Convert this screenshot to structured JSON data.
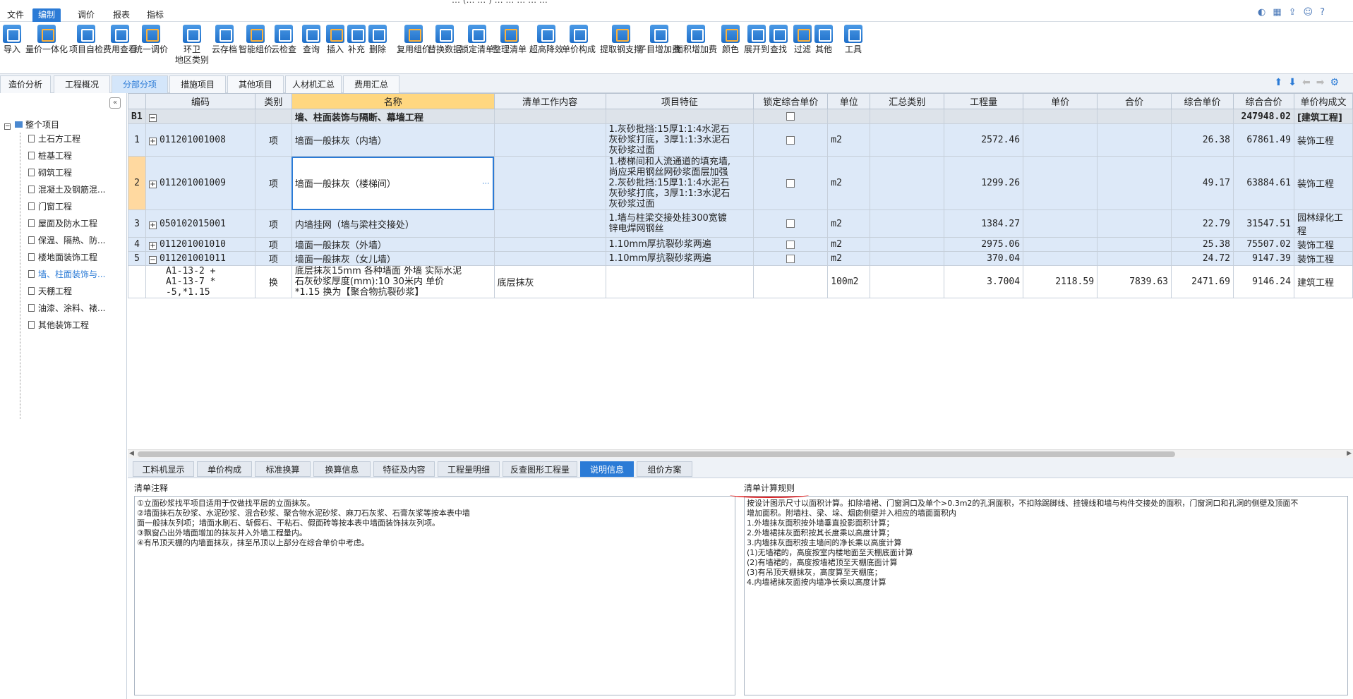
{
  "menu": [
    "文件",
    "编制",
    "调价",
    "报表",
    "指标"
  ],
  "title_fragment": "…  (… …  )  …  …  …  …  …",
  "ribbon": [
    {
      "label": "导入",
      "icon": "import-icon"
    },
    {
      "label": "量价一体化",
      "icon": "price-quantity-icon"
    },
    {
      "label": "项目自检",
      "icon": "self-check-icon"
    },
    {
      "label": "费用查看",
      "icon": "cost-view-icon"
    },
    {
      "label": "统一调价",
      "icon": "adjust-price-icon"
    },
    {
      "label": "环卫",
      "label2": "地区类别",
      "icon": "region-icon"
    },
    {
      "label": "云存档",
      "icon": "cloud-save-icon"
    },
    {
      "label": "智能组价",
      "icon": "smart-price-icon"
    },
    {
      "label": "云检查",
      "icon": "cloud-check-icon"
    },
    {
      "label": "查询",
      "icon": "query-icon"
    },
    {
      "label": "插入",
      "icon": "insert-icon"
    },
    {
      "label": "补充",
      "icon": "supplement-icon"
    },
    {
      "label": "删除",
      "icon": "delete-icon"
    },
    {
      "label": "复用组价",
      "icon": "reuse-icon"
    },
    {
      "label": "替换数据",
      "icon": "replace-icon"
    },
    {
      "label": "锁定清单",
      "icon": "lock-icon"
    },
    {
      "label": "整理清单",
      "icon": "organize-icon"
    },
    {
      "label": "超高降效",
      "icon": "height-icon"
    },
    {
      "label": "单价构成",
      "icon": "unit-price-icon"
    },
    {
      "label": "提取钢支撑",
      "icon": "steel-icon"
    },
    {
      "label": "子目增加费",
      "icon": "add-fee-icon"
    },
    {
      "label": "面积增加费",
      "icon": "area-fee-icon"
    },
    {
      "label": "颜色",
      "icon": "color-icon"
    },
    {
      "label": "展开到",
      "icon": "expand-icon"
    },
    {
      "label": "查找",
      "icon": "find-icon"
    },
    {
      "label": "过滤",
      "icon": "filter-icon"
    },
    {
      "label": "其他",
      "icon": "other-icon"
    },
    {
      "label": "工具",
      "icon": "tools-icon"
    }
  ],
  "main_tabs": [
    "造价分析",
    "工程概况",
    "分部分项",
    "措施项目",
    "其他项目",
    "人材机汇总",
    "费用汇总"
  ],
  "tree": {
    "root": "整个项目",
    "items": [
      "土石方工程",
      "桩基工程",
      "砌筑工程",
      "混凝土及钢筋混...",
      "门窗工程",
      "屋面及防水工程",
      "保温、隔热、防...",
      "楼地面装饰工程",
      "墙、柱面装饰与...",
      "天棚工程",
      "油漆、涂料、裱...",
      "其他装饰工程"
    ],
    "selected_index": 8
  },
  "columns": [
    "",
    "编码",
    "类别",
    "名称",
    "清单工作内容",
    "项目特征",
    "锁定综合单价",
    "单位",
    "汇总类别",
    "工程量",
    "单价",
    "合价",
    "综合单价",
    "综合合价",
    "单价构成文"
  ],
  "b1": {
    "no": "B1",
    "name": "墙、柱面装饰与隔断、幕墙工程",
    "total": "247948.02",
    "cat": "[建筑工程]"
  },
  "rows": [
    {
      "no": "1",
      "code": "011201001008",
      "type": "项",
      "name": "墙面一般抹灰（内墙）",
      "content": "",
      "feature": "1.灰砂批挡:15厚1:1:4水泥石\n灰砂浆打底，3厚1:1:3水泥石\n灰砂浆过面",
      "unit": "m2",
      "qty": "2572.46",
      "price": "",
      "amount": "",
      "uprice": "26.38",
      "total": "67861.49",
      "comp": "装饰工程"
    },
    {
      "no": "2",
      "code": "011201001009",
      "type": "项",
      "name": "墙面一般抹灰（楼梯间）",
      "content": "",
      "feature": "1.楼梯间和人流通道的填充墙,\n尚应采用钢丝网砂浆面层加强\n2.灰砂批挡:15厚1:1:4水泥石\n灰砂浆打底，3厚1:1:3水泥石\n灰砂浆过面",
      "unit": "m2",
      "qty": "1299.26",
      "price": "",
      "amount": "",
      "uprice": "49.17",
      "total": "63884.61",
      "comp": "装饰工程"
    },
    {
      "no": "3",
      "code": "050102015001",
      "type": "项",
      "name": "内墙挂网（墙与梁柱交接处）",
      "content": "",
      "feature": "1.墙与柱梁交接处挂300宽镀\n锌电焊网钢丝",
      "unit": "m2",
      "qty": "1384.27",
      "price": "",
      "amount": "",
      "uprice": "22.79",
      "total": "31547.51",
      "comp": "园林绿化工程"
    },
    {
      "no": "4",
      "code": "011201001010",
      "type": "项",
      "name": "墙面一般抹灰（外墙）",
      "content": "",
      "feature": " 1.10mm厚抗裂砂浆两遍",
      "unit": "m2",
      "qty": "2975.06",
      "price": "",
      "amount": "",
      "uprice": "25.38",
      "total": "75507.02",
      "comp": "装饰工程"
    },
    {
      "no": "5",
      "code": "011201001011",
      "type": "项",
      "name": "墙面一般抹灰（女儿墙）",
      "content": "",
      "feature": " 1.10mm厚抗裂砂浆两遍",
      "unit": "m2",
      "qty": "370.04",
      "price": "",
      "amount": "",
      "uprice": "24.72",
      "total": "9147.39",
      "comp": "装饰工程"
    }
  ],
  "sub": {
    "code": "A1-13-2 +\nA1-13-7 *\n-5,*1.15",
    "type": "换",
    "name": "底层抹灰15mm 各种墙面 外墙  实际水泥\n石灰砂浆厚度(mm):10  30米内 单价\n*1.15  换为【聚合物抗裂砂浆】",
    "content": "底层抹灰",
    "unit": "100m2",
    "qty": "3.7004",
    "price": "2118.59",
    "amount": "7839.63",
    "uprice": "2471.69",
    "total": "9146.24",
    "comp": "建筑工程"
  },
  "bottom_tabs": [
    "工料机显示",
    "单价构成",
    "标准换算",
    "换算信息",
    "特征及内容",
    "工程量明细",
    "反查图形工程量",
    "说明信息",
    "组价方案"
  ],
  "left_panel": {
    "title": "清单注释",
    "text": "①立面砂浆找平项目适用于仅做找平层的立面抹灰。\n②墙面抹石灰砂浆、水泥砂浆、混合砂浆、聚合物水泥砂浆、麻刀石灰浆、石膏灰浆等按本表中墙\n面一般抹灰列项；墙面水刷石、斩假石、干粘石、假面砖等按本表中墙面装饰抹灰列项。\n③飘窗凸出外墙面增加的抹灰并入外墙工程量内。\n④有吊顶天棚的内墙面抹灰，抹至吊顶以上部分在综合单价中考虑。"
  },
  "right_panel": {
    "title": "清单计算规则",
    "text": "按设计图示尺寸以面积计算。扣除墙裙、门窗洞口及单个>0.3m2的孔洞面积，不扣除踢脚线、挂镜线和墙与构件交接处的面积，门窗洞口和孔洞的侧壁及顶面不\n增加面积。附墙柱、梁、垛、烟囱侧壁并入相应的墙面面积内\n1.外墙抹灰面积按外墙垂直投影面积计算；\n2.外墙裙抹灰面积按其长度乘以高度计算；\n3.内墙抹灰面积按主墙间的净长乘以高度计算\n(1)无墙裙的，高度按室内楼地面至天棚底面计算\n(2)有墙裙的，高度按墙裙顶至天棚底面计算\n(3)有吊顶天棚抹灰，高度算至天棚底；\n4.内墙裙抹灰面按内墙净长乘以高度计算"
  },
  "colors": {
    "accent": "#2b7bd6",
    "header": "#ffd780",
    "row_bg": "#dde9f8"
  }
}
